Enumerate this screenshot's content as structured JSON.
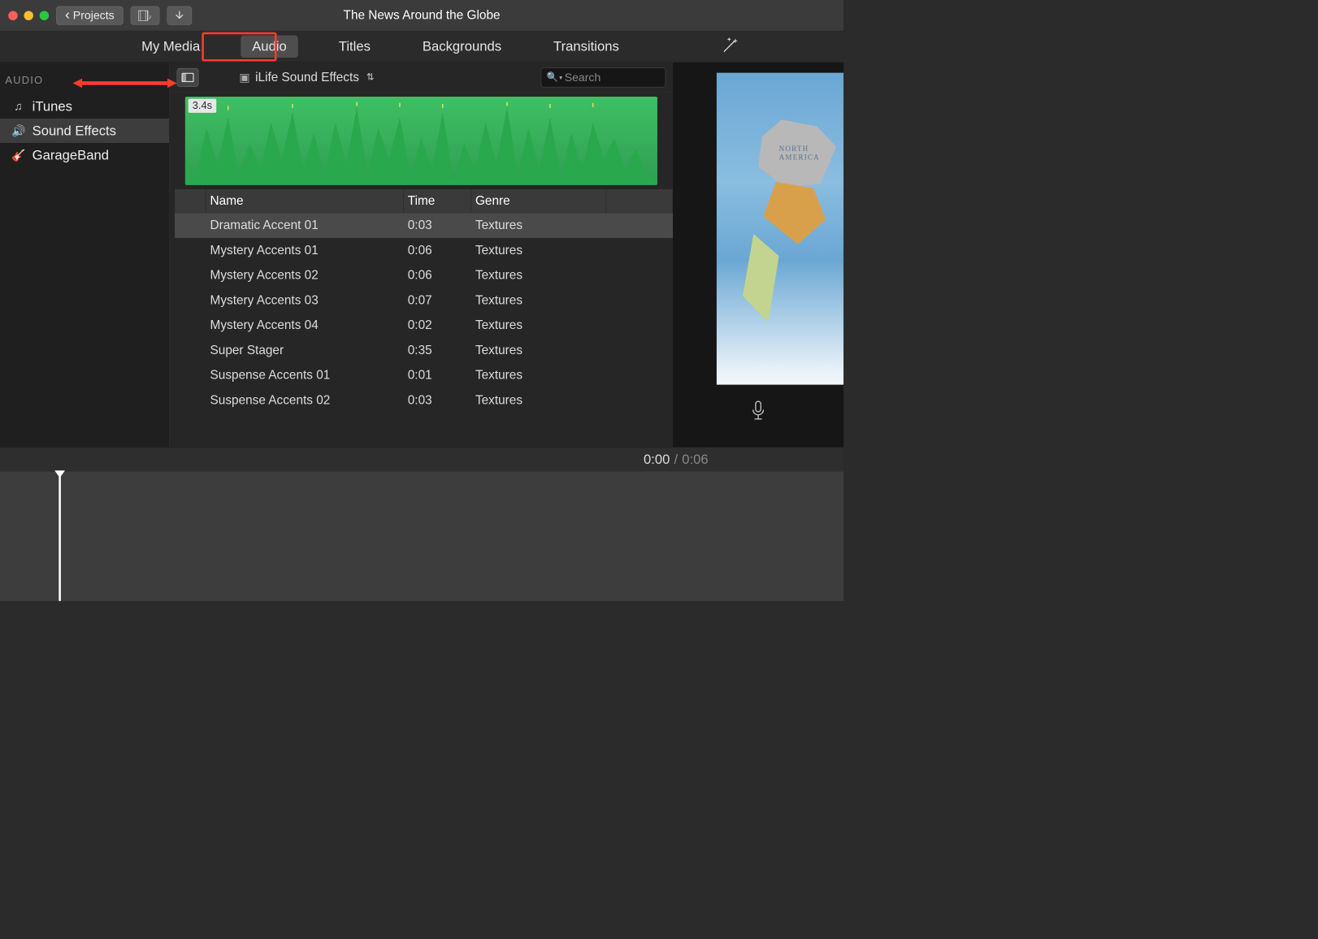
{
  "titlebar": {
    "projects_button": "Projects",
    "project_title": "The News Around the Globe"
  },
  "tabs": {
    "my_media": "My Media",
    "audio": "Audio",
    "titles": "Titles",
    "backgrounds": "Backgrounds",
    "transitions": "Transitions",
    "active": "audio"
  },
  "sidebar": {
    "section_title": "AUDIO",
    "items": [
      {
        "id": "itunes",
        "label": "iTunes",
        "icon": "♫"
      },
      {
        "id": "sound-effects",
        "label": "Sound Effects",
        "icon": "🔊",
        "selected": true
      },
      {
        "id": "garageband",
        "label": "GarageBand",
        "icon": "🎸"
      }
    ]
  },
  "browser": {
    "library_name": "iLife Sound Effects",
    "search_placeholder": "Search",
    "waveform_badge": "3.4s",
    "columns": {
      "name": "Name",
      "time": "Time",
      "genre": "Genre"
    },
    "rows": [
      {
        "name": "Dramatic Accent 01",
        "time": "0:03",
        "genre": "Textures",
        "selected": true
      },
      {
        "name": "Mystery Accents 01",
        "time": "0:06",
        "genre": "Textures"
      },
      {
        "name": "Mystery Accents 02",
        "time": "0:06",
        "genre": "Textures"
      },
      {
        "name": "Mystery Accents 03",
        "time": "0:07",
        "genre": "Textures"
      },
      {
        "name": "Mystery Accents 04",
        "time": "0:02",
        "genre": "Textures"
      },
      {
        "name": "Super Stager",
        "time": "0:35",
        "genre": "Textures"
      },
      {
        "name": "Suspense Accents 01",
        "time": "0:01",
        "genre": "Textures"
      },
      {
        "name": "Suspense Accents 02",
        "time": "0:03",
        "genre": "Textures"
      }
    ]
  },
  "preview": {
    "map_labels": {
      "north_america": "NORTH AMERICA"
    }
  },
  "timeline": {
    "current": "0:00",
    "separator": "/",
    "duration": "0:06"
  },
  "colors": {
    "annotation_red": "#ff3b30",
    "waveform_green": "#3fbf64"
  }
}
